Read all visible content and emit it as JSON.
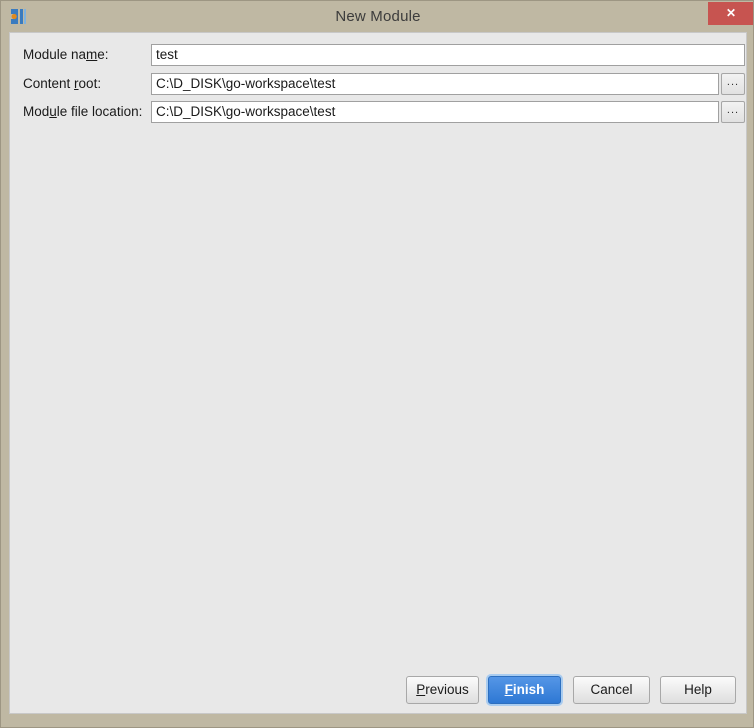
{
  "window": {
    "title": "New Module",
    "app_icon": "intellij-logo-icon",
    "close_label": "✕",
    "frame_color": "#bfb8a3",
    "panel_color": "#e8e8e8",
    "close_color": "#c75450"
  },
  "form": {
    "rows": [
      {
        "label_before": "Module na",
        "label_mnemonic": "m",
        "label_after": "e:",
        "value": "test",
        "has_browse": false
      },
      {
        "label_before": "Content ",
        "label_mnemonic": "r",
        "label_after": "oot:",
        "value": "C:\\D_DISK\\go-workspace\\test",
        "has_browse": true
      },
      {
        "label_before": "Mod",
        "label_mnemonic": "u",
        "label_after": "le file location:",
        "value": "C:\\D_DISK\\go-workspace\\test",
        "has_browse": true
      }
    ],
    "browse_label": "..."
  },
  "buttons": {
    "previous": {
      "before": "",
      "mnemonic": "P",
      "after": "revious"
    },
    "finish": {
      "before": "",
      "mnemonic": "F",
      "after": "inish",
      "accent": "#2e78d4"
    },
    "cancel": {
      "before": "Cancel",
      "mnemonic": "",
      "after": ""
    },
    "help": {
      "before": "Help",
      "mnemonic": "",
      "after": ""
    }
  }
}
